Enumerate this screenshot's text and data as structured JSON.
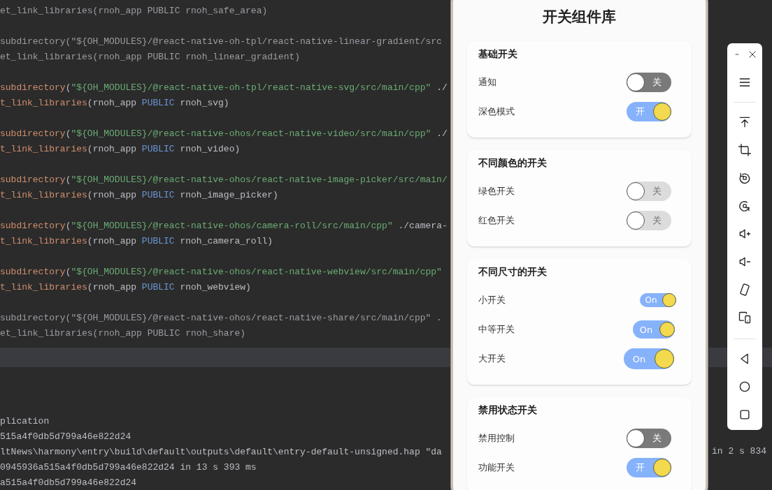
{
  "editor": {
    "lines": [
      {
        "segments": [
          {
            "kind": "dim",
            "text": "et_link_libraries(rnoh_app PUBLIC rnoh_safe_area)"
          }
        ]
      },
      {
        "kind": "blank"
      },
      {
        "segments": [
          {
            "kind": "dim",
            "text": "subdirectory(\"${OH_MODULES}/@react-native-oh-tpl/react-native-linear-gradient/src"
          }
        ]
      },
      {
        "segments": [
          {
            "kind": "dim",
            "text": "et_link_libraries(rnoh_app PUBLIC rnoh_linear_gradient)"
          }
        ]
      },
      {
        "kind": "blank"
      },
      {
        "segments": [
          {
            "kind": "fn",
            "text": "subdirectory"
          },
          {
            "kind": "punct",
            "text": "("
          },
          {
            "kind": "str",
            "text": "\"${OH_MODULES}/@react-native-oh-tpl/react-native-svg/src/main/cpp\""
          },
          {
            "kind": "punct",
            "text": " ./"
          }
        ]
      },
      {
        "segments": [
          {
            "kind": "fn",
            "text": "t_link_libraries"
          },
          {
            "kind": "punct",
            "text": "(rnoh_app "
          },
          {
            "kind": "keyword",
            "text": "PUBLIC"
          },
          {
            "kind": "punct",
            "text": " rnoh_svg)"
          }
        ]
      },
      {
        "kind": "blank"
      },
      {
        "segments": [
          {
            "kind": "fn",
            "text": "subdirectory"
          },
          {
            "kind": "punct",
            "text": "("
          },
          {
            "kind": "str",
            "text": "\"${OH_MODULES}/@react-native-ohos/react-native-video/src/main/cpp\""
          },
          {
            "kind": "punct",
            "text": " ./"
          }
        ]
      },
      {
        "segments": [
          {
            "kind": "fn",
            "text": "t_link_libraries"
          },
          {
            "kind": "punct",
            "text": "(rnoh_app "
          },
          {
            "kind": "keyword",
            "text": "PUBLIC"
          },
          {
            "kind": "punct",
            "text": " rnoh_video)"
          }
        ]
      },
      {
        "kind": "blank"
      },
      {
        "segments": [
          {
            "kind": "fn",
            "text": "subdirectory"
          },
          {
            "kind": "punct",
            "text": "("
          },
          {
            "kind": "str",
            "text": "\"${OH_MODULES}/@react-native-ohos/react-native-image-picker/src/main/"
          }
        ]
      },
      {
        "segments": [
          {
            "kind": "fn",
            "text": "t_link_libraries"
          },
          {
            "kind": "punct",
            "text": "(rnoh_app "
          },
          {
            "kind": "keyword",
            "text": "PUBLIC"
          },
          {
            "kind": "punct",
            "text": " rnoh_image_picker)"
          }
        ]
      },
      {
        "kind": "blank"
      },
      {
        "segments": [
          {
            "kind": "fn",
            "text": "subdirectory"
          },
          {
            "kind": "punct",
            "text": "("
          },
          {
            "kind": "str",
            "text": "\"${OH_MODULES}/@react-native-ohos/camera-roll/src/main/cpp\""
          },
          {
            "kind": "punct",
            "text": " ./camera-"
          }
        ]
      },
      {
        "segments": [
          {
            "kind": "fn",
            "text": "t_link_libraries"
          },
          {
            "kind": "punct",
            "text": "(rnoh_app "
          },
          {
            "kind": "keyword",
            "text": "PUBLIC"
          },
          {
            "kind": "punct",
            "text": " rnoh_camera_roll)"
          }
        ]
      },
      {
        "kind": "blank"
      },
      {
        "segments": [
          {
            "kind": "fn",
            "text": "subdirectory"
          },
          {
            "kind": "punct",
            "text": "("
          },
          {
            "kind": "str",
            "text": "\"${OH_MODULES}/@react-native-ohos/react-native-webview/src/main/cpp\""
          }
        ]
      },
      {
        "segments": [
          {
            "kind": "fn",
            "text": "t_link_libraries"
          },
          {
            "kind": "punct",
            "text": "(rnoh_app "
          },
          {
            "kind": "keyword",
            "text": "PUBLIC"
          },
          {
            "kind": "punct",
            "text": " rnoh_webview)"
          }
        ]
      },
      {
        "kind": "blank"
      },
      {
        "segments": [
          {
            "kind": "dim",
            "text": "subdirectory(\"${OH_MODULES}/@react-native-ohos/react-native-share/src/main/cpp\" ."
          }
        ]
      },
      {
        "segments": [
          {
            "kind": "dim",
            "text": "et_link_libraries(rnoh_app PUBLIC rnoh_share)"
          }
        ]
      }
    ]
  },
  "console": {
    "lines": [
      {
        "text": "plication"
      },
      {
        "text": "515a4f0db5d799a46e822d24"
      },
      {
        "text": "ltNews\\harmony\\entry\\build\\default\\outputs\\default\\entry-default-unsigned.hap \"da",
        "tail": "in 2 s 834"
      },
      {
        "text": "0945936a515a4f0db5d799a46e822d24 in 13 s 393 ms"
      },
      {
        "text": "a515a4f0db5d799a46e822d24"
      }
    ]
  },
  "app": {
    "title": "开关组件库",
    "sections": [
      {
        "title": "基础开关",
        "items": [
          {
            "label": "通知",
            "on": false,
            "text": "关",
            "kind": "standard"
          },
          {
            "label": "深色模式",
            "on": true,
            "text": "开",
            "kind": "standard"
          }
        ]
      },
      {
        "title": "不同颜色的开关",
        "items": [
          {
            "label": "绿色开关",
            "on": false,
            "text": "关",
            "kind": "muted"
          },
          {
            "label": "红色开关",
            "on": false,
            "text": "关",
            "kind": "muted"
          }
        ]
      },
      {
        "title": "不同尺寸的开关",
        "items": [
          {
            "label": "小开关",
            "on": true,
            "text": "On",
            "kind": "small"
          },
          {
            "label": "中等开关",
            "on": true,
            "text": "On",
            "kind": "medium"
          },
          {
            "label": "大开关",
            "on": true,
            "text": "On",
            "kind": "large"
          }
        ]
      },
      {
        "title": "禁用状态开关",
        "items": [
          {
            "label": "禁用控制",
            "on": false,
            "text": "关",
            "kind": "standard"
          },
          {
            "label": "功能开关",
            "on": true,
            "text": "开",
            "kind": "standard"
          }
        ]
      }
    ]
  }
}
